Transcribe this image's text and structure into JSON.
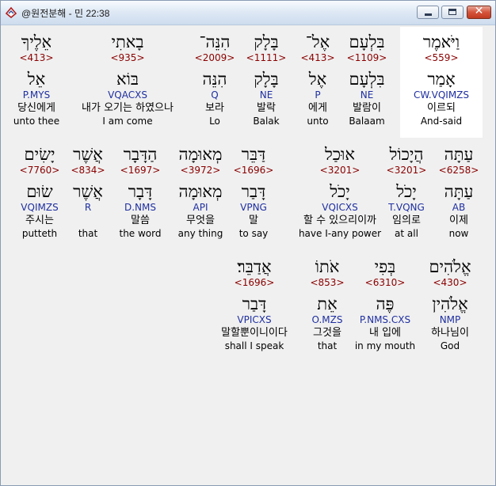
{
  "window": {
    "title": "@원전분해 - 민 22:38"
  },
  "rows": [
    [
      {
        "heb": "וַיֹּאמֶר",
        "num": "<559>",
        "lex": "אָמַר",
        "parse": "CW.VQIMZS",
        "kor": "이르되",
        "eng": "And-said",
        "selected": true
      },
      {
        "heb": "בִּלְעָם",
        "num": "<1109>",
        "lex": "בִּלְעָם",
        "parse": "NE",
        "kor": "발람이",
        "eng": "Balaam"
      },
      {
        "heb": "אֶל־",
        "num": "<413>",
        "lex": "אֶל",
        "parse": "P",
        "kor": "에게",
        "eng": "unto"
      },
      {
        "heb": "בָּלָק",
        "num": "<1111>",
        "lex": "בָּלָק",
        "parse": "NE",
        "kor": "발락",
        "eng": "Balak"
      },
      {
        "heb": "הִנֵּה־",
        "num": "<2009>",
        "lex": "הִנֵּה",
        "parse": "Q",
        "kor": "보라",
        "eng": "Lo"
      },
      {
        "heb": "בָאתִי",
        "num": "<935>",
        "lex": "בּוֹא",
        "parse": "VQACXS",
        "kor": "내가 오기는 하였으나",
        "eng": "I am come"
      },
      {
        "heb": "אֵלֶיךָ",
        "num": "<413>",
        "lex": "אֵל",
        "parse": "P.MYS",
        "kor": "당신에게",
        "eng": "unto thee"
      }
    ],
    [
      {
        "heb": "עַתָּה",
        "num": "<6258>",
        "lex": "עַתָּה",
        "parse": "AB",
        "kor": "이제",
        "eng": "now"
      },
      {
        "heb": "הֲיָכוֹל",
        "num": "<3201>",
        "lex": "יָכֹל",
        "parse": "T.VQNG",
        "kor": "임의로",
        "eng": "at all"
      },
      {
        "heb": "אוּכַל",
        "num": "<3201>",
        "lex": "יָכֹל",
        "parse": "VQICXS",
        "kor": "할 수 있으리이까",
        "eng": "have I-any power"
      },
      {
        "heb": "דַּבֵּר",
        "num": "<1696>",
        "lex": "דָּבַר",
        "parse": "VPNG",
        "kor": "말",
        "eng": "to say"
      },
      {
        "heb": "מְאוּמָה",
        "num": "<3972>",
        "lex": "מְאוּמָה",
        "parse": "API",
        "kor": "무엇을",
        "eng": "any thing"
      },
      {
        "heb": "הַדָּבָר",
        "num": "<1697>",
        "lex": "דָּבָר",
        "parse": "D.NMS",
        "kor": "말씀",
        "eng": "the word"
      },
      {
        "heb": "אֲשֶׁר",
        "num": "<834>",
        "lex": "אֲשֶׁר",
        "parse": "R",
        "kor": "",
        "eng": "that"
      },
      {
        "heb": "יָשִׂים",
        "num": "<7760>",
        "lex": "שׂוּם",
        "parse": "VQIMZS",
        "kor": "주시는",
        "eng": "putteth"
      }
    ],
    [
      {
        "heb": "אֱלֹהִים",
        "num": "<430>",
        "lex": "אֱלֹהִין",
        "parse": "NMP",
        "kor": "하나님이",
        "eng": "God"
      },
      {
        "heb": "בְּפִי",
        "num": "<6310>",
        "lex": "פֶּה",
        "parse": "P.NMS.CXS",
        "kor": "내 입에",
        "eng": "in my mouth"
      },
      {
        "heb": "אֹתוֹ",
        "num": "<853>",
        "lex": "אֵת",
        "parse": "O.MZS",
        "kor": "그것을",
        "eng": "that"
      },
      {
        "heb": "אֲדַבֵּר׃",
        "num": "<1696>",
        "lex": "דָּבַר",
        "parse": "VPICXS",
        "kor": "말할뿐이니이다",
        "eng": "shall I speak"
      }
    ]
  ]
}
